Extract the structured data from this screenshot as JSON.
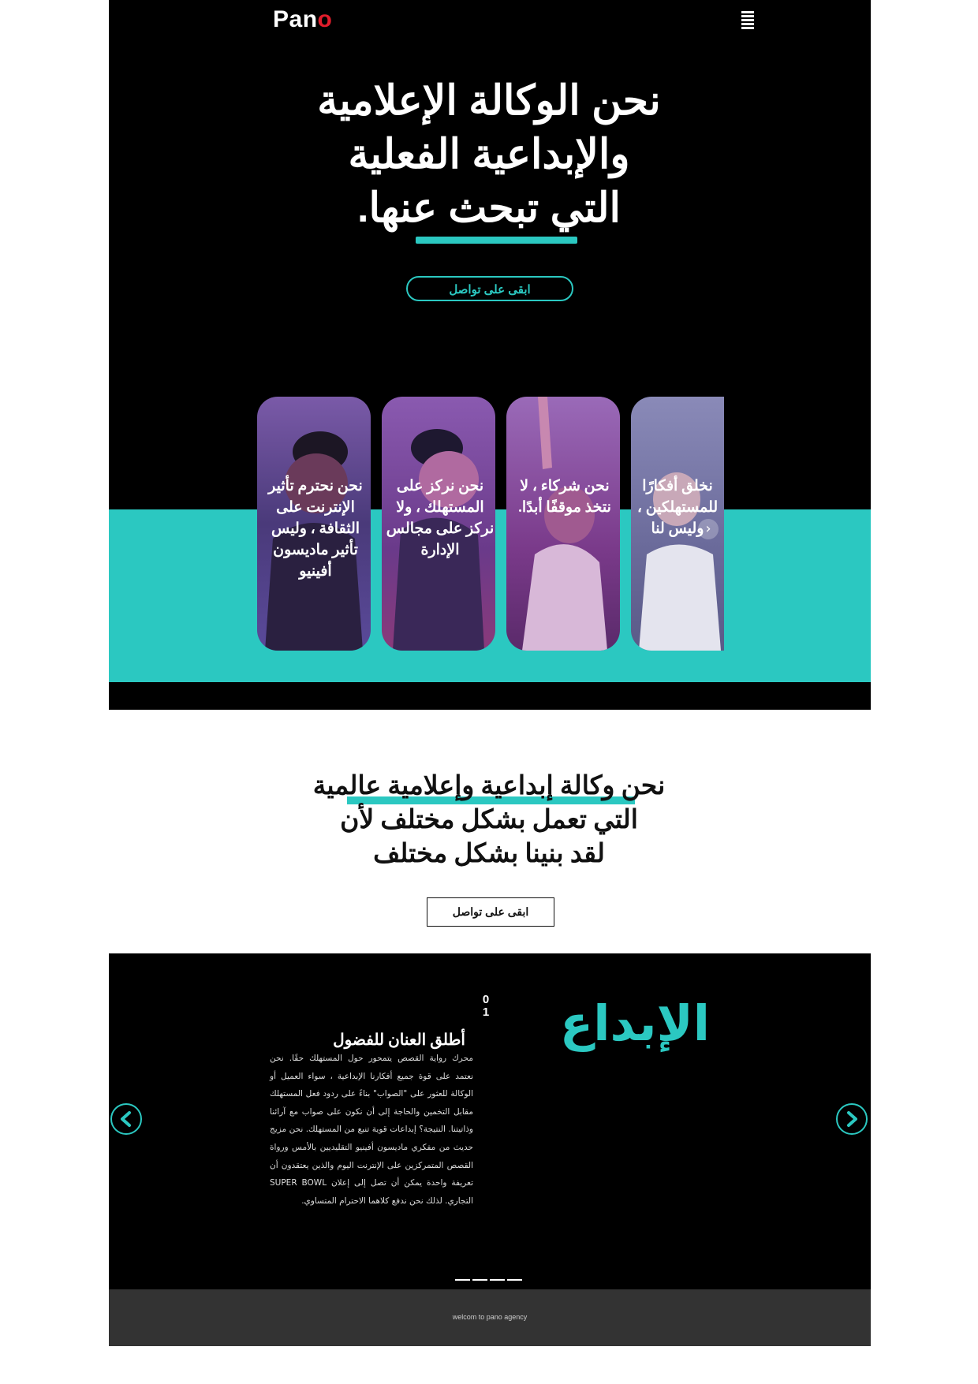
{
  "colors": {
    "accent": "#2bc8c1",
    "logo_accent": "#e11d2b",
    "dark": "#000000",
    "footer_bg": "#333333"
  },
  "header": {
    "logo_main": "Pan",
    "logo_accent": "o",
    "menu_icon": "hamburger-icon"
  },
  "hero": {
    "title_line1": "نحن الوكالة الإعلامية",
    "title_line2": "والإبداعية الفعلية",
    "title_line3": "التي تبحث عنها.",
    "button_label": "ابقى على تواصل"
  },
  "cards": [
    {
      "text": "نحن نحترم تأثير الإنترنت على الثقافة ، وليس تأثير ماديسون أفينيو"
    },
    {
      "text": "نحن نركز على المستهلك ، ولا نركز على مجالس الإدارة"
    },
    {
      "text": "نحن شركاء ، لا نتخذ موقفًا أبدًا."
    },
    {
      "text": "نخلق أفكارًا للمستهلكين ، وليس لنا"
    }
  ],
  "cards_next_icon": "chevron-right-icon",
  "about": {
    "title_line1": "نحن وكالة إبداعية وإعلامية عالمية",
    "title_line2": "التي تعمل بشكل مختلف لأن",
    "title_line3": "لقد بنينا بشكل مختلف",
    "button_label": "ابقى على تواصل"
  },
  "slider": {
    "big_word": "الإبداع",
    "number_top": "0",
    "number_bottom": "1",
    "heading": "أطلق العنان للفضول",
    "body": "محرك رواية القصص يتمحور حول المستهلك حقًا. نحن نعتمد على قوة جميع أفكارنا الإبداعية ، سواء العميل أو الوكالة للعثور على \"الصواب\" بناءً على ردود فعل المستهلك مقابل التخمين والحاجة إلى أن نكون على صواب مع آرائنا وذاتيتنا. النتيجة؟ إبداعات قوية تنبع من المستهلك. نحن مزيج حديث من مفكري ماديسون أفينيو التقليديين بالأمس ورواة القصص المتمركزين على الإنترنت اليوم والذين يعتقدون أن تعريفة واحدة يمكن أن تصل إلى إعلان SUPER BOWL التجاري. لذلك نحن ندفع كلاهما الاحترام المتساوي.",
    "prev_icon": "chevron-left-icon",
    "next_icon": "chevron-right-icon",
    "dots_count": 4
  },
  "footer": {
    "text": "welcom to pano agency"
  }
}
